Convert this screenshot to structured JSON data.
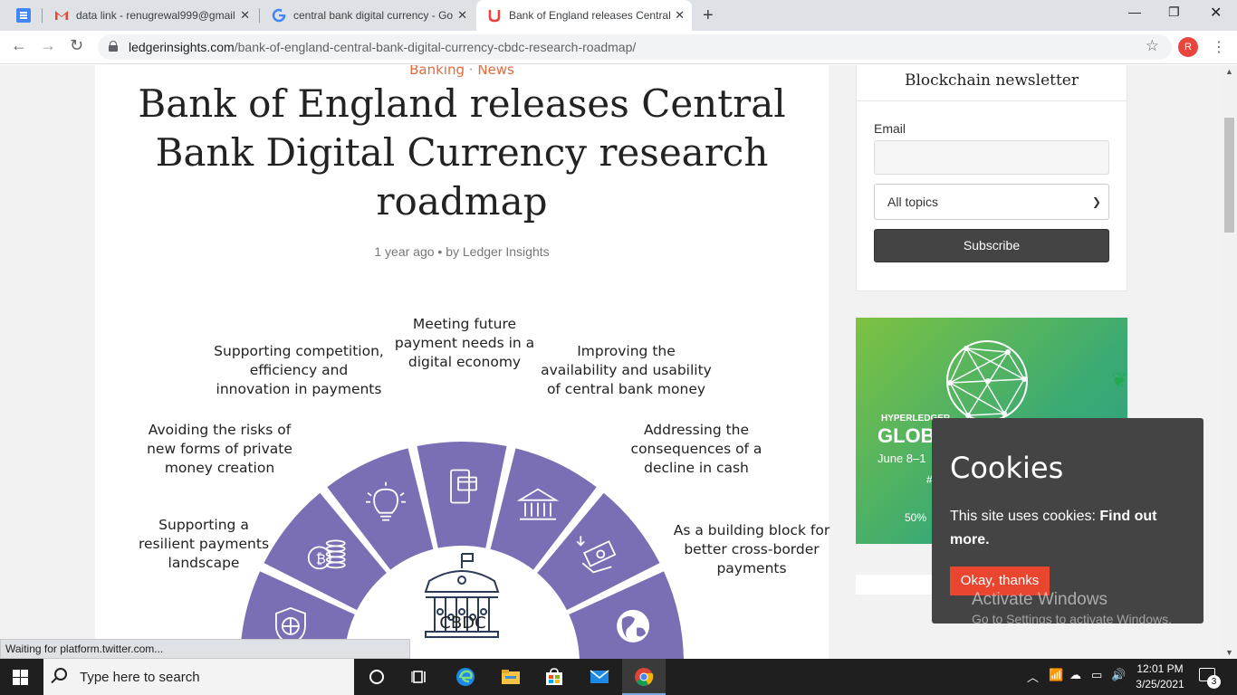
{
  "browser": {
    "tabs": [
      {
        "label": "data link - renugrewal999@gmail",
        "active": false
      },
      {
        "label": "central bank digital currency - Go",
        "active": false
      },
      {
        "label": "Bank of England releases Central",
        "active": true
      }
    ],
    "url_host": "ledgerinsights.com",
    "url_path": "/bank-of-england-central-bank-digital-currency-cbdc-research-roadmap/",
    "profile_initial": "R",
    "status_text": "Waiting for platform.twitter.com..."
  },
  "article": {
    "category1": "Banking",
    "category_sep": "·",
    "category2": "News",
    "headline": "Bank of England releases Central Bank Digital Currency research roadmap",
    "byline_time": "1 year ago",
    "byline_sep": "•",
    "byline_author": "by Ledger Insights",
    "figure": {
      "center_label": "CBDC",
      "segments": [
        {
          "label_lines": [
            "Supporting a",
            "resilient payments",
            "landscape"
          ],
          "icon": "shield-icon"
        },
        {
          "label_lines": [
            "Avoiding the risks of",
            "new forms of private",
            "money creation"
          ],
          "icon": "coins-icon"
        },
        {
          "label_lines": [
            "Supporting competition,",
            "efficiency and",
            "innovation in payments"
          ],
          "icon": "lightbulb-icon"
        },
        {
          "label_lines": [
            "Meeting future",
            "payment needs in a",
            "digital economy"
          ],
          "icon": "mobile-payment-icon"
        },
        {
          "label_lines": [
            "Improving the",
            "availability and usability",
            "of central bank money"
          ],
          "icon": "bank-icon"
        },
        {
          "label_lines": [
            "Addressing the",
            "consequences of a",
            "decline in cash"
          ],
          "icon": "cash-icon"
        },
        {
          "label_lines": [
            "As a building block for",
            "better cross-border",
            "payments"
          ],
          "icon": "globe-icon"
        }
      ],
      "segment_color": "#7a6eb4"
    }
  },
  "sidebar": {
    "newsletter_title": "Blockchain newsletter",
    "email_label": "Email",
    "topic_selected": "All topics",
    "subscribe_label": "Subscribe",
    "ad": {
      "small": "HYPERLEDGER",
      "big": "GLOB",
      "date": "June 8–1",
      "hash": "#",
      "off": "50%"
    }
  },
  "cookie": {
    "title": "Cookies",
    "text": "This site uses cookies:",
    "link": "Find out more.",
    "button": "Okay, thanks"
  },
  "watermark": {
    "line1": "Activate Windows",
    "line2": "Go to Settings to activate Windows."
  },
  "taskbar": {
    "search_placeholder": "Type here to search",
    "time": "12:01 PM",
    "date": "3/25/2021",
    "notification_count": "3"
  }
}
